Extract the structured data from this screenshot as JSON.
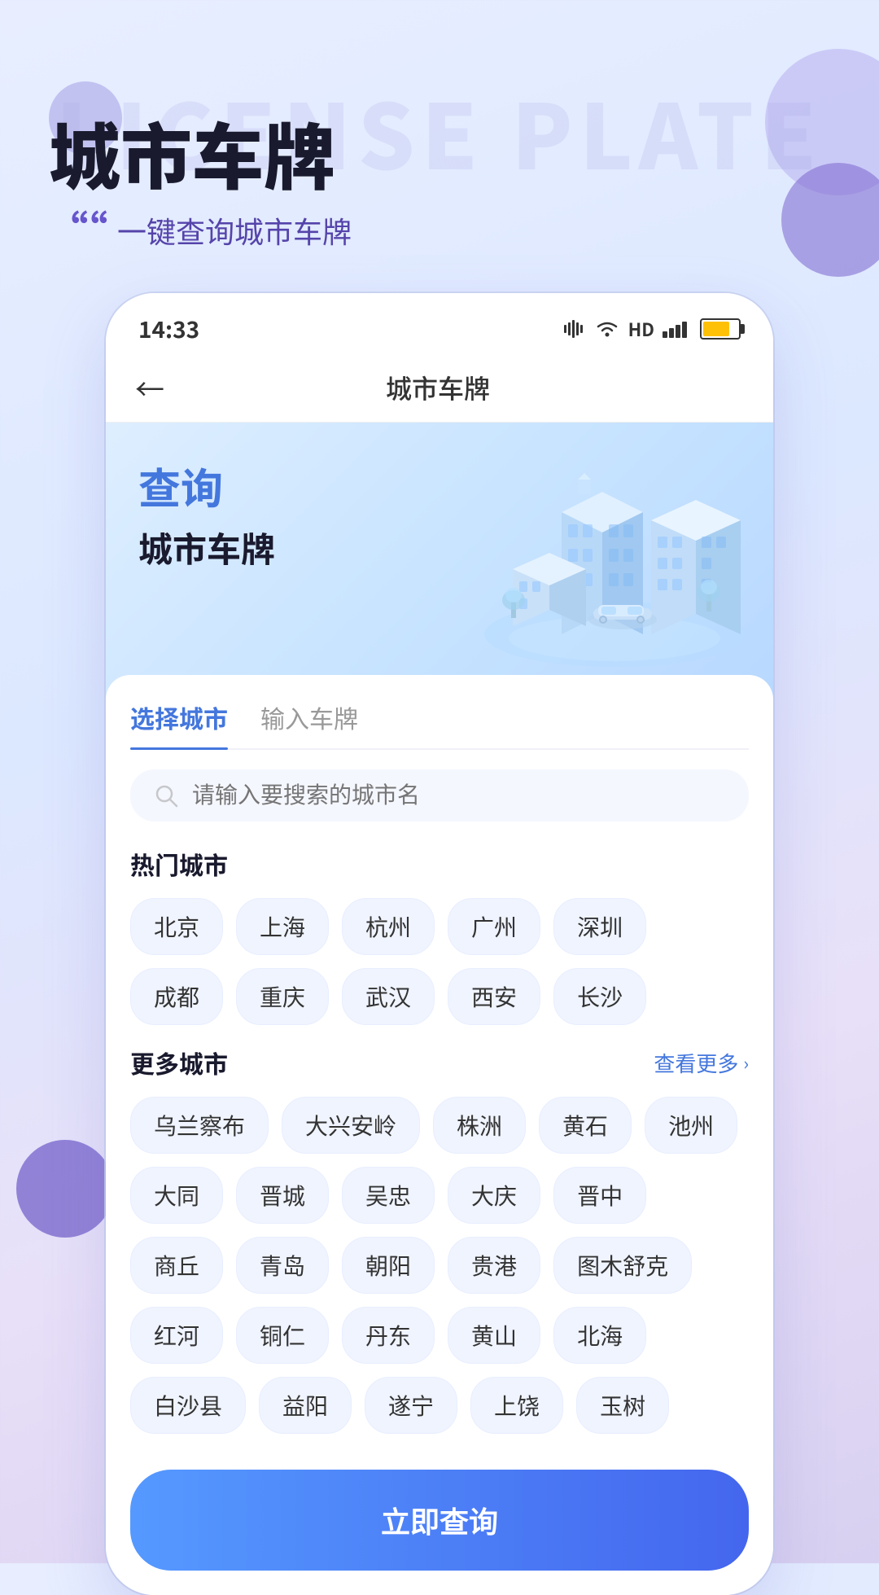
{
  "background": {
    "watermark": "LICENSE PLATE"
  },
  "header": {
    "main_title": "城市车牌",
    "quote_mark": "““",
    "subtitle": "一键查询城市车牌"
  },
  "phone": {
    "status_bar": {
      "time": "14:33",
      "icons": "📶 🔋"
    },
    "nav": {
      "back_label": "←",
      "title": "城市车牌"
    },
    "hero": {
      "query_label": "查询",
      "sub_label": "城市车牌"
    },
    "tabs": [
      {
        "label": "选择城市",
        "active": true
      },
      {
        "label": "输入车牌",
        "active": false
      }
    ],
    "search": {
      "placeholder": "请输入要搜索的城市名"
    },
    "hot_cities": {
      "title": "热门城市",
      "items": [
        "北京",
        "上海",
        "杭州",
        "广州",
        "深圳",
        "成都",
        "重庆",
        "武汉",
        "西安",
        "长沙"
      ]
    },
    "more_cities": {
      "title": "更多城市",
      "view_more": "查看更多",
      "items": [
        "乌兰察布",
        "大兴安岭",
        "株洲",
        "黄石",
        "池州",
        "大同",
        "晋城",
        "吴忠",
        "大庆",
        "晋中",
        "商丘",
        "青岛",
        "朝阳",
        "贵港",
        "图木舒克",
        "红河",
        "铜仁",
        "丹东",
        "黄山",
        "北海",
        "白沙县",
        "益阳",
        "遂宁",
        "上饶",
        "玉树"
      ]
    },
    "query_button": "立即查询"
  }
}
